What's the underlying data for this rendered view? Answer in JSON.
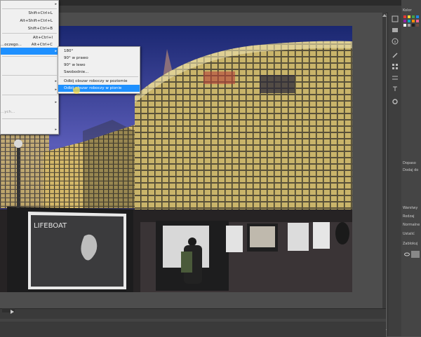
{
  "colors": {
    "menu_bg": "#f0f0f0",
    "highlight": "#1e90ff",
    "workspace": "#4d4d4d",
    "panel": "#454545"
  },
  "main_menu": {
    "items": [
      {
        "label": "",
        "shortcut": "",
        "arrow": "▸"
      },
      {
        "label": "",
        "shortcut": "Shift+Ctrl+L",
        "arrow": ""
      },
      {
        "label": "",
        "shortcut": "Alt+Shift+Ctrl+L",
        "arrow": ""
      },
      {
        "label": "",
        "shortcut": "Shift+Ctrl+B",
        "arrow": ""
      },
      {
        "label": "",
        "shortcut": "Alt+Ctrl+I",
        "arrow": ""
      },
      {
        "label": "...oczego...",
        "shortcut": "Alt+Ctrl+C",
        "arrow": ""
      },
      {
        "label": "",
        "shortcut": "",
        "arrow": "▸"
      },
      {
        "label": "",
        "shortcut": "",
        "arrow": "▸"
      },
      {
        "label": "",
        "shortcut": "",
        "arrow": "▸"
      },
      {
        "label": "",
        "shortcut": "",
        "arrow": "▸"
      },
      {
        "label": "...ych...",
        "shortcut": "",
        "arrow": ""
      },
      {
        "label": "",
        "shortcut": "",
        "arrow": "▸"
      }
    ]
  },
  "rotate_submenu": {
    "items": [
      {
        "label": "180°"
      },
      {
        "label": "90° w prawo"
      },
      {
        "label": "90° w lewo"
      },
      {
        "label": "Swobodnie..."
      },
      {
        "label": "Odbij obszar roboczy w poziomie"
      },
      {
        "label": "Odbij obszar roboczy w pionie"
      }
    ],
    "highlighted_index": 5
  },
  "photo": {
    "billboard_text": "LIFEBOAT"
  },
  "right_panel": {
    "tabs": [
      "Kolor",
      "Dopaso",
      "Dodaj do",
      "Warstwy",
      "Rodzaj",
      "Normalne",
      "Ustalić",
      "Zablokuj"
    ]
  }
}
